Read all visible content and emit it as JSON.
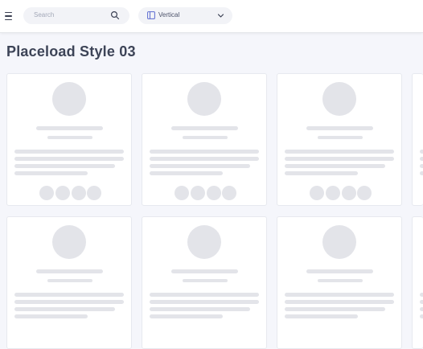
{
  "header": {
    "menu_icon": "hamburger-menu-icon",
    "search": {
      "placeholder": "Search",
      "icon": "search-icon"
    },
    "layout_select": {
      "icon": "layout-panel-icon",
      "value": "Vertical",
      "chevron": "chevron-down-icon"
    }
  },
  "page": {
    "title": "Placeload Style 03"
  },
  "colors": {
    "background": "#f5f6fb",
    "placeholder": "#e3e4e9",
    "title": "#3d4457"
  }
}
